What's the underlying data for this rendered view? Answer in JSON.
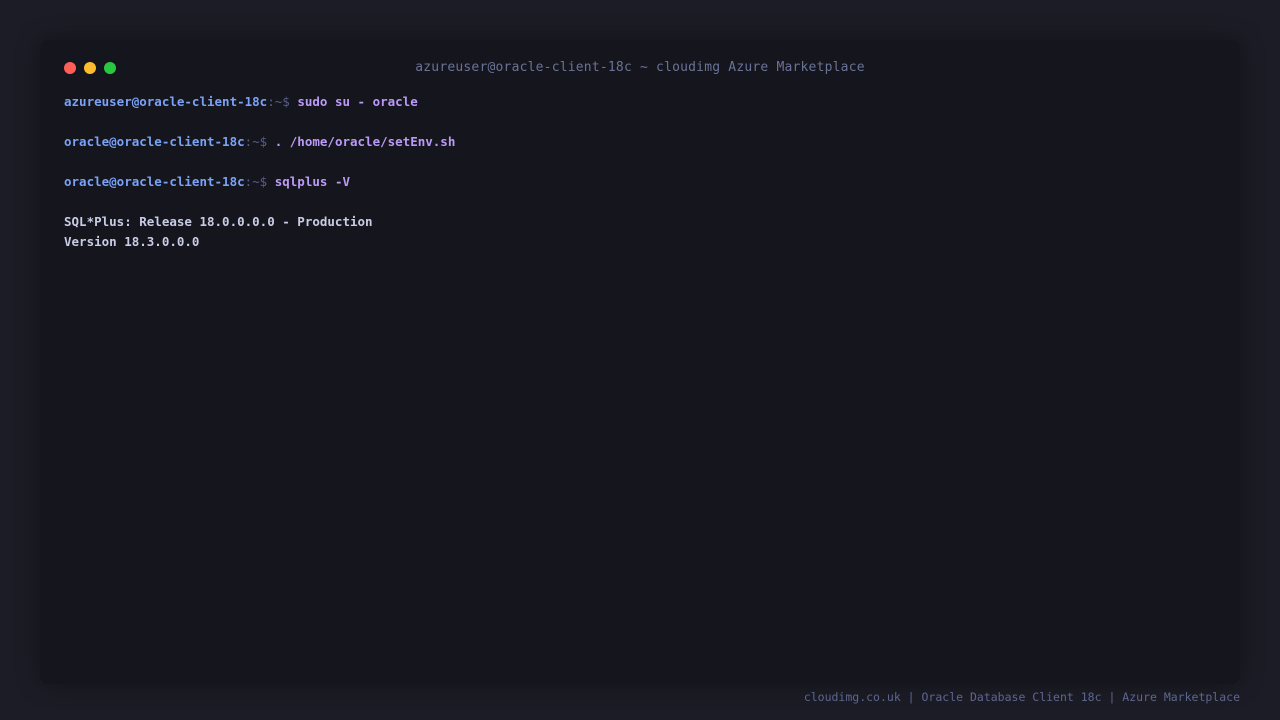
{
  "window": {
    "title": "azureuser@oracle-client-18c ~ cloudimg Azure Marketplace"
  },
  "terminal": {
    "lines": [
      {
        "user": "azureuser@oracle-client-18c",
        "sep": ":~$ ",
        "cmd": "sudo su - oracle"
      },
      {
        "user": "oracle@oracle-client-18c",
        "sep": ":~$ ",
        "cmd": ". /home/oracle/setEnv.sh"
      },
      {
        "user": "oracle@oracle-client-18c",
        "sep": ":~$ ",
        "cmd": "sqlplus -V"
      }
    ],
    "output": [
      "SQL*Plus: Release 18.0.0.0.0 - Production",
      "Version 18.3.0.0.0"
    ]
  },
  "footer": {
    "text": "cloudimg.co.uk | Oracle Database Client 18c | Azure Marketplace"
  },
  "colors": {
    "background": "#1c1c26",
    "terminal_bg": "#15151d",
    "user": "#7aa2f7",
    "command": "#bb9af7",
    "output": "#c8cde6"
  }
}
